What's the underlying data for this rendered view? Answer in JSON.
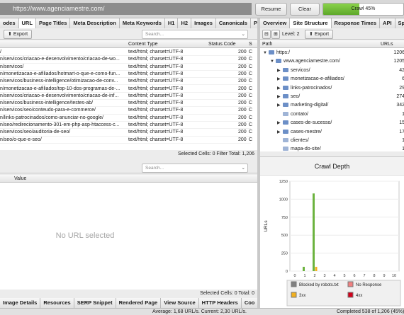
{
  "topbar": {
    "url": "https://www.agenciamestre.com/",
    "resume_label": "Resume",
    "clear_label": "Clear",
    "progress_label": "Crawl 45%",
    "progress_value": 45
  },
  "main_tabs": [
    "odes",
    "URL",
    "Page Titles",
    "Meta Description",
    "Meta Keywords",
    "H1",
    "H2",
    "Images",
    "Canonicals",
    "Pa"
  ],
  "left_toolbar": {
    "export_label": "Export",
    "search_placeholder": "Search..."
  },
  "left_table": {
    "columns": [
      "",
      "Content Type",
      "Status Code",
      "S"
    ],
    "rows": [
      {
        "url": "/",
        "type": "text/html; charset=UTF-8",
        "code": "200",
        "s": "C"
      },
      {
        "url": "n/servicos/criacao-e-desenvolvimento/criacao-de-wo...",
        "type": "text/html; charset=UTF-8",
        "code": "200",
        "s": "C"
      },
      {
        "url": "n/servicos/",
        "type": "text/html; charset=UTF-8",
        "code": "200",
        "s": "C"
      },
      {
        "url": "n/monetizacao-e-afiliados/hotmart-o-que-e-como-fun...",
        "type": "text/html; charset=UTF-8",
        "code": "200",
        "s": "C"
      },
      {
        "url": "n/servicos/business-intelligence/otimizacao-de-conv...",
        "type": "text/html; charset=UTF-8",
        "code": "200",
        "s": "C"
      },
      {
        "url": "n/monetizacao-e-afiliados/top-10-dos-programas-de-...",
        "type": "text/html; charset=UTF-8",
        "code": "200",
        "s": "C"
      },
      {
        "url": "n/servicos/criacao-e-desenvolvimento/criacao-de-inf...",
        "type": "text/html; charset=UTF-8",
        "code": "200",
        "s": "C"
      },
      {
        "url": "n/servicos/business-intelligence/testes-ab/",
        "type": "text/html; charset=UTF-8",
        "code": "200",
        "s": "C"
      },
      {
        "url": "n/servicos/seo/conteudo-para-e-commerce/",
        "type": "text/html; charset=UTF-8",
        "code": "200",
        "s": "C"
      },
      {
        "url": "n/links-patrocinados/como-anunciar-no-google/",
        "type": "text/html; charset=UTF-8",
        "code": "200",
        "s": "C"
      },
      {
        "url": "n/seo/redirecionamento-301-em-php-asp-htaccess-c...",
        "type": "text/html; charset=UTF-8",
        "code": "200",
        "s": "C"
      },
      {
        "url": "n/servicos/seo/auditoria-de-seo/",
        "type": "text/html; charset=UTF-8",
        "code": "200",
        "s": "C"
      },
      {
        "url": "n/seo/o-que-e-seo/",
        "type": "text/html; charset=UTF-8",
        "code": "200",
        "s": "C"
      }
    ],
    "status": "Selected Cells:  0  Filter Total:  1,206"
  },
  "lower_left": {
    "search_placeholder": "Search...",
    "columns": [
      "",
      "Value"
    ],
    "empty_text": "No URL selected",
    "status": "Selected Cells:  0  Total:  0"
  },
  "bottom_tabs": [
    "Image Details",
    "Resources",
    "SERP Snippet",
    "Rendered Page",
    "View Source",
    "HTTP Headers",
    "Coo"
  ],
  "right_tabs": [
    "Overview",
    "Site Structure",
    "Response Times",
    "API",
    "Spe"
  ],
  "right_toolbar": {
    "level_label": "Level: 2",
    "export_label": "Export"
  },
  "tree": {
    "columns": [
      "Path",
      "URLs"
    ],
    "rows": [
      {
        "label": "https:/",
        "urls": "1206",
        "depth": 0,
        "expanded": true
      },
      {
        "label": "www.agenciamestre.com/",
        "urls": "1205",
        "depth": 1,
        "expanded": true
      },
      {
        "label": "servicos/",
        "urls": "42",
        "depth": 2,
        "expanded": false
      },
      {
        "label": "monetizacao-e-afiliados/",
        "urls": "6",
        "depth": 2,
        "expanded": false
      },
      {
        "label": "links-patrocinados/",
        "urls": "29",
        "depth": 2,
        "expanded": false
      },
      {
        "label": "seo/",
        "urls": "274",
        "depth": 2,
        "expanded": false
      },
      {
        "label": "marketing-digital/",
        "urls": "342",
        "depth": 2,
        "expanded": false
      },
      {
        "label": "contato/",
        "urls": "1",
        "depth": 2,
        "expanded": null
      },
      {
        "label": "cases-de-sucesso/",
        "urls": "15",
        "depth": 2,
        "expanded": false
      },
      {
        "label": "cases-mestre/",
        "urls": "17",
        "depth": 2,
        "expanded": false
      },
      {
        "label": "clientes/",
        "urls": "1",
        "depth": 2,
        "expanded": null
      },
      {
        "label": "mapa-do-site/",
        "urls": "1",
        "depth": 2,
        "expanded": null
      }
    ]
  },
  "chart_data": {
    "type": "bar",
    "title": "Crawl Depth",
    "ylabel": "URLs",
    "xlabel": "",
    "categories": [
      "0",
      "1",
      "2",
      "3",
      "4",
      "5",
      "6",
      "7",
      "8",
      "9",
      "10"
    ],
    "ylim": [
      0,
      1250
    ],
    "yticks": [
      0,
      250,
      500,
      750,
      1000,
      1250
    ],
    "series": [
      {
        "name": "Blocked by robots.txt",
        "color": "#808080",
        "values": [
          0,
          0,
          0,
          0,
          0,
          0,
          0,
          0,
          0,
          0,
          0
        ]
      },
      {
        "name": "No Response",
        "color": "#f08080",
        "values": [
          0,
          0,
          0,
          0,
          0,
          0,
          0,
          0,
          0,
          0,
          0
        ]
      },
      {
        "name": "2xx",
        "color": "#6cb33f",
        "values": [
          0,
          60,
          1080,
          0,
          0,
          0,
          0,
          0,
          0,
          0,
          0
        ]
      },
      {
        "name": "3xx",
        "color": "#f2b01e",
        "values": [
          0,
          0,
          60,
          0,
          0,
          0,
          0,
          0,
          0,
          0,
          0
        ]
      },
      {
        "name": "4xx",
        "color": "#d0021b",
        "values": [
          0,
          0,
          0,
          0,
          0,
          0,
          0,
          0,
          0,
          0,
          0
        ]
      }
    ],
    "legend_position": "bottom"
  },
  "footer": {
    "speed": "Average: 1,68 URL/s. Current: 2,30 URL/s.",
    "completed": "Completed 538 of 1,206 (45%)"
  }
}
